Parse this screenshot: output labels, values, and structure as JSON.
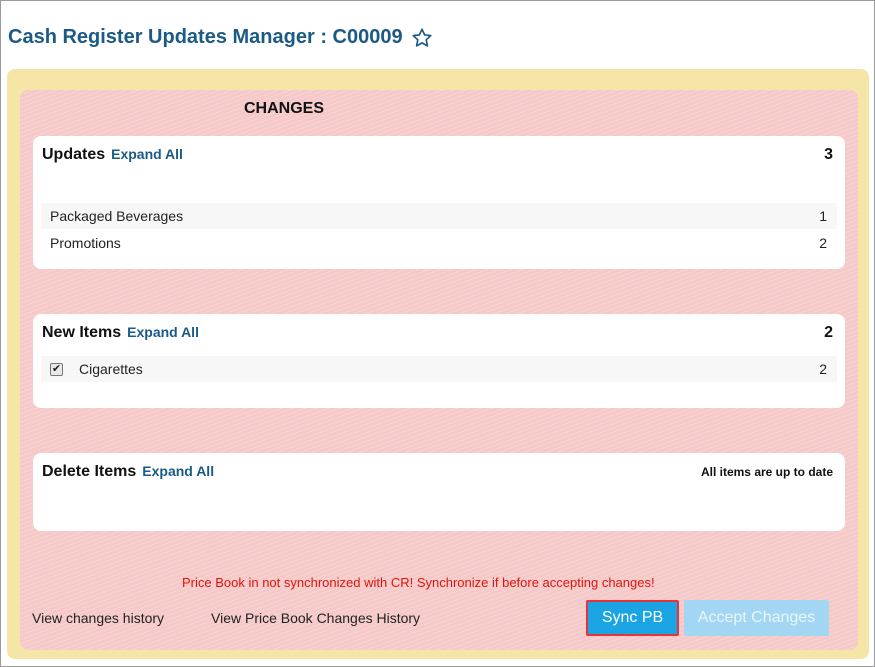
{
  "header": {
    "title": "Cash Register Updates Manager : C00009",
    "favorite_icon": "star-outline-icon"
  },
  "changes": {
    "heading": "CHANGES",
    "updates": {
      "title": "Updates",
      "expand_label": "Expand All",
      "count": "3",
      "rows": [
        {
          "label": "Packaged Beverages",
          "count": "1"
        },
        {
          "label": "Promotions",
          "count": "2"
        }
      ]
    },
    "new_items": {
      "title": "New Items",
      "expand_label": "Expand All",
      "count": "2",
      "rows": [
        {
          "label": "Cigarettes",
          "count": "2",
          "checked": true
        }
      ]
    },
    "delete_items": {
      "title": "Delete Items",
      "expand_label": "Expand All",
      "status": "All items are up to date"
    }
  },
  "footer": {
    "warning": "Price Book in not synchronized with CR! Synchronize if before accepting changes!",
    "view_changes_history": "View changes history",
    "view_price_book_history": "View Price Book Changes History",
    "sync_button": "Sync PB",
    "accept_button": "Accept Changes"
  },
  "colors": {
    "title": "#1c5a86",
    "outer_panel": "#f5e6a8",
    "inner_panel": "#f6c9c9",
    "warning": "#e0140e",
    "sync_button": "#1ba4e4",
    "sync_border": "#e8333a",
    "accept_button_disabled": "#a3d6f3"
  }
}
